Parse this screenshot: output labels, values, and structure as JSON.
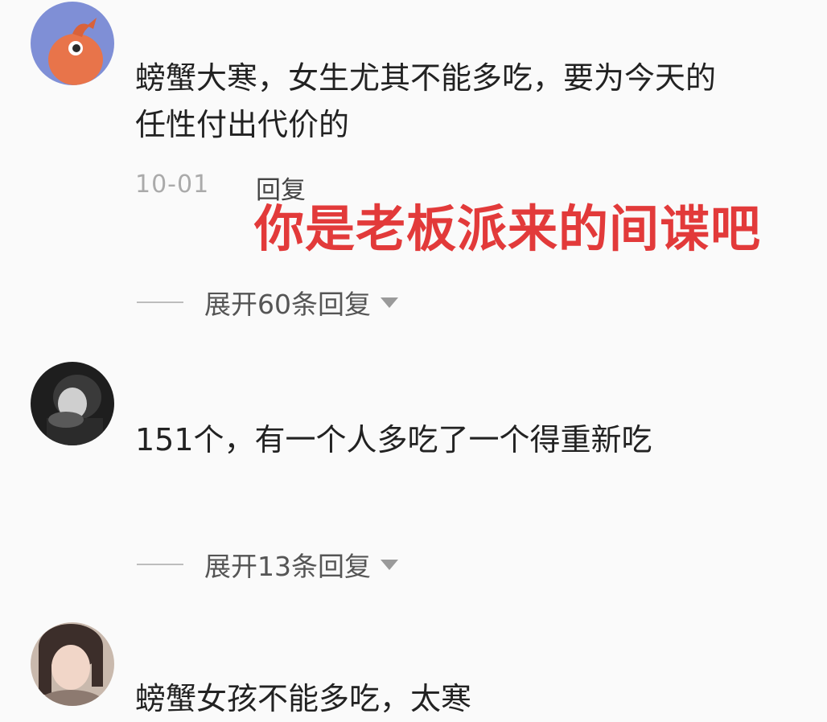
{
  "comments": [
    {
      "avatar_icon": "orange-bird-avatar",
      "text": "螃蟹大寒，女生尤其不能多吃，要为今天的\n任性付出代价的",
      "date": "10-01",
      "reply_label": "回复",
      "overlay_caption": "你是老板派来的间谍吧",
      "expand_label": "展开60条回复"
    },
    {
      "avatar_icon": "dark-photo-avatar",
      "text": "151个，有一个人多吃了一个得重新吃",
      "expand_label": "展开13条回复"
    },
    {
      "avatar_icon": "girl-photo-avatar",
      "text": "螃蟹女孩不能多吃，太寒"
    }
  ],
  "colors": {
    "background": "#fafafa",
    "overlay_caption": "#e23a3a",
    "date": "#aaaaaa"
  }
}
